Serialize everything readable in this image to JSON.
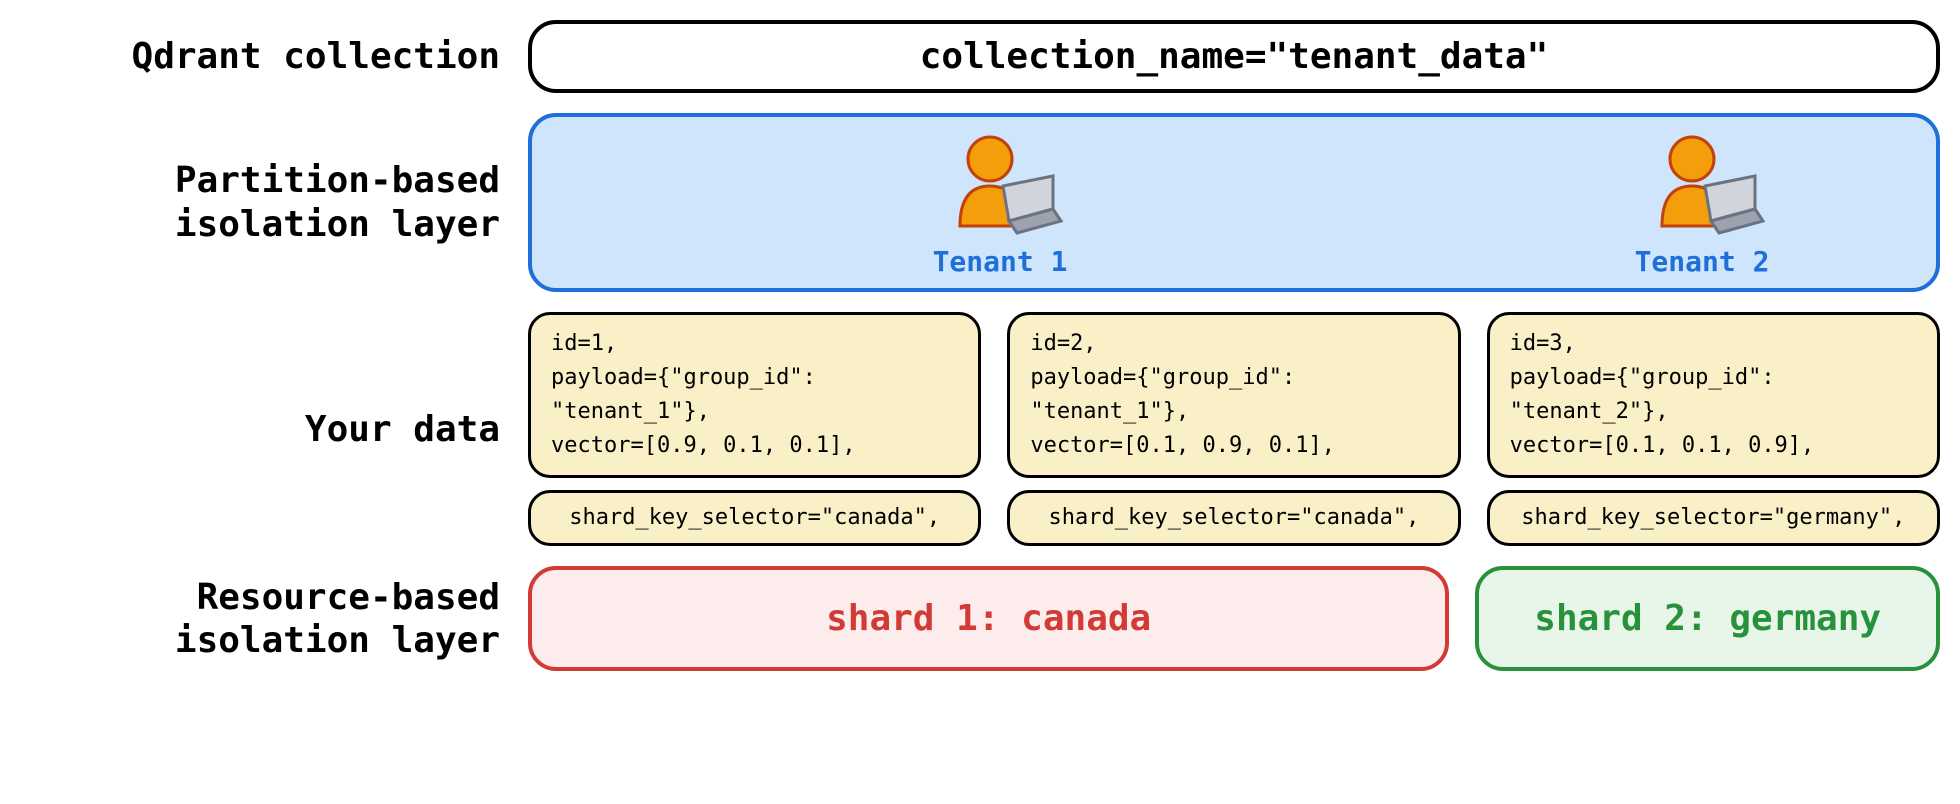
{
  "labels": {
    "qdrant_collection": "Qdrant collection",
    "partition_layer_l1": "Partition-based",
    "partition_layer_l2": "isolation layer",
    "your_data": "Your data",
    "resource_layer_l1": "Resource-based",
    "resource_layer_l2": "isolation layer"
  },
  "collection_expr": "collection_name=\"tenant_data\"",
  "tenants": {
    "t1": "Tenant 1",
    "t2": "Tenant 2"
  },
  "records": {
    "r1": {
      "id_line": "id=1,",
      "payload_line": "payload={\"group_id\": \"tenant_1\"},",
      "vector_line": "vector=[0.9, 0.1, 0.1],",
      "shard_line": "shard_key_selector=\"canada\","
    },
    "r2": {
      "id_line": "id=2,",
      "payload_line": "payload={\"group_id\": \"tenant_1\"},",
      "vector_line": "vector=[0.1, 0.9, 0.1],",
      "shard_line": "shard_key_selector=\"canada\","
    },
    "r3": {
      "id_line": "id=3,",
      "payload_line": "payload={\"group_id\": \"tenant_2\"},",
      "vector_line": "vector=[0.1, 0.1, 0.9],",
      "shard_line": "shard_key_selector=\"germany\","
    }
  },
  "shards": {
    "s1": "shard 1: canada",
    "s2": "shard 2: germany"
  }
}
